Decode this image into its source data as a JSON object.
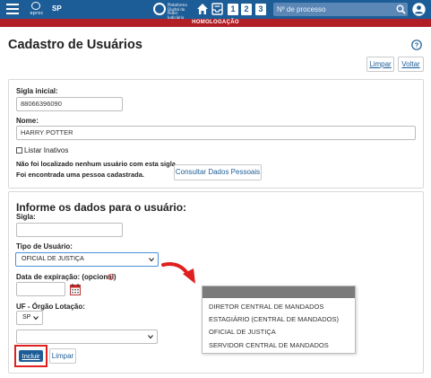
{
  "topbar": {
    "brand": "eproc",
    "uf": "SP",
    "tribunal_lines": [
      "Plataforma",
      "Digital do",
      "Poder Judiciário"
    ],
    "quick_buttons": [
      "1",
      "2",
      "3"
    ],
    "search_placeholder": "Nº de processo",
    "environment": "HOMOLOGAÇÃO",
    "accent": "#1d5d97",
    "env_color": "#b21e25"
  },
  "page": {
    "title": "Cadastro de Usuários",
    "limpar": "Limpar",
    "voltar": "Voltar"
  },
  "search_panel": {
    "sigla_label": "Sigla inicial:",
    "sigla_value": "88066396090",
    "nome_label": "Nome:",
    "nome_value": "HARRY POTTER",
    "listar_inativos": "Listar Inativos",
    "msg_line1": "Não foi localizado nenhum usuário com esta sigla.",
    "msg_line2": "Foi encontrada uma pessoa cadastrada.",
    "consultar_button": "Consultar Dados Pessoais"
  },
  "form": {
    "title": "Informe os dados para o usuário:",
    "sigla_label": "Sigla:",
    "sigla_value": "",
    "tipo_label": "Tipo de Usuário:",
    "tipo_value": "OFICIAL DE JUSTIÇA",
    "expiracao_label": "Data de expiração: (opcional)",
    "expiracao_value": "",
    "uf_label": "UF - Órgão Lotação:",
    "uf_value": "SP",
    "orgao_value": "",
    "incluir": "Incluir",
    "limpar": "Limpar"
  },
  "tipo_options": [
    "DIRETOR CENTRAL DE MANDADOS",
    "ESTAGIÁRIO (CENTRAL DE MANDADOS)",
    "OFICIAL DE JUSTIÇA",
    "SERVIDOR CENTRAL DE MANDADOS"
  ],
  "icons": {
    "menu": "hamburger-menu-icon",
    "home": "home-icon",
    "tray": "inbox-tray-icon",
    "search": "search-icon",
    "user": "user-avatar-icon",
    "help": "help-circle-icon",
    "calendar": "calendar-icon",
    "arrow": "red-curved-arrow-icon"
  }
}
